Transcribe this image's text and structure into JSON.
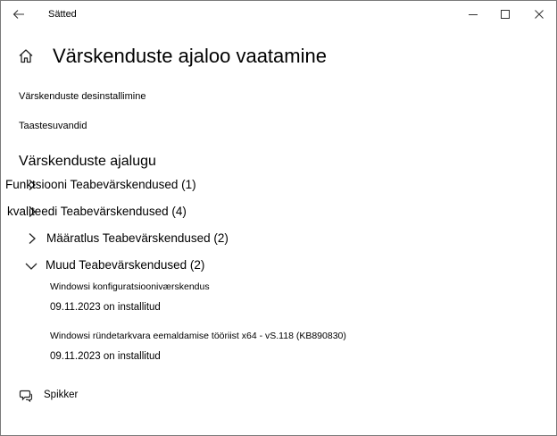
{
  "window": {
    "title": "Sätted"
  },
  "page": {
    "title": "Värskenduste ajaloo vaatamine"
  },
  "links": {
    "uninstall": "Värskenduste desinstallimine",
    "recovery": "Taastesuvandid"
  },
  "history": {
    "heading": "Värskenduste ajalugu",
    "categories": [
      {
        "label": "Funktsiooni Teabevärskendused (1)",
        "expanded": false
      },
      {
        "label": "kvaliteedi Teabevärskendused (4)",
        "expanded": false
      },
      {
        "label": "Määratlus Teabevärskendused (2)",
        "expanded": false
      },
      {
        "label": "Muud Teabevärskendused (2)",
        "expanded": true
      }
    ],
    "items": [
      {
        "name": "Windowsi konfiguratsiooniværskendus",
        "status": "09.11.2023 on installitud"
      },
      {
        "name": "Windowsi ründetarkvara eemaldamise tööriist x64 - vS.118 (KB890830)",
        "status": "09.11.2023 on installitud"
      }
    ]
  },
  "help": {
    "label": "Spikker"
  },
  "icons": {
    "back": "back-arrow-icon",
    "minimize": "minimize-icon",
    "maximize": "maximize-icon",
    "close": "close-icon",
    "home": "home-icon",
    "chevron_right": "chevron-right-icon",
    "chevron_down": "chevron-down-icon",
    "help": "help-chat-icon"
  }
}
